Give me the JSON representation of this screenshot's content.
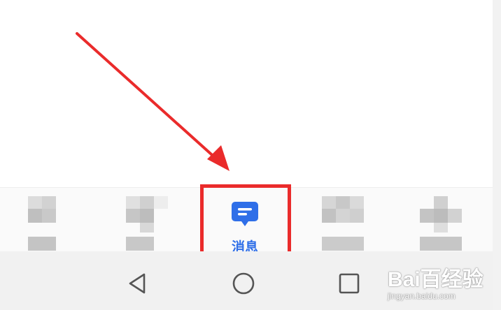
{
  "tabbar": {
    "tabs": [
      {
        "name": "tab-1",
        "blurred": true
      },
      {
        "name": "tab-2",
        "blurred": true
      },
      {
        "name": "tab-messages",
        "label": "消息",
        "icon": "message-icon",
        "active": true
      },
      {
        "name": "tab-4",
        "blurred": true
      },
      {
        "name": "tab-5",
        "blurred": true
      }
    ]
  },
  "navbar": {
    "buttons": [
      {
        "icon": "back-triangle-icon"
      },
      {
        "icon": "home-circle-icon"
      },
      {
        "icon": "recents-square-icon"
      }
    ]
  },
  "annotation": {
    "arrow_color": "#ea2b2b",
    "box_color": "#ea2b2b"
  },
  "watermark": {
    "logo": "Bai百经验",
    "url": "jingyan.baidu.com"
  },
  "colors": {
    "accent": "#2f6fe8",
    "navbar_bg": "#f1f1f1"
  }
}
